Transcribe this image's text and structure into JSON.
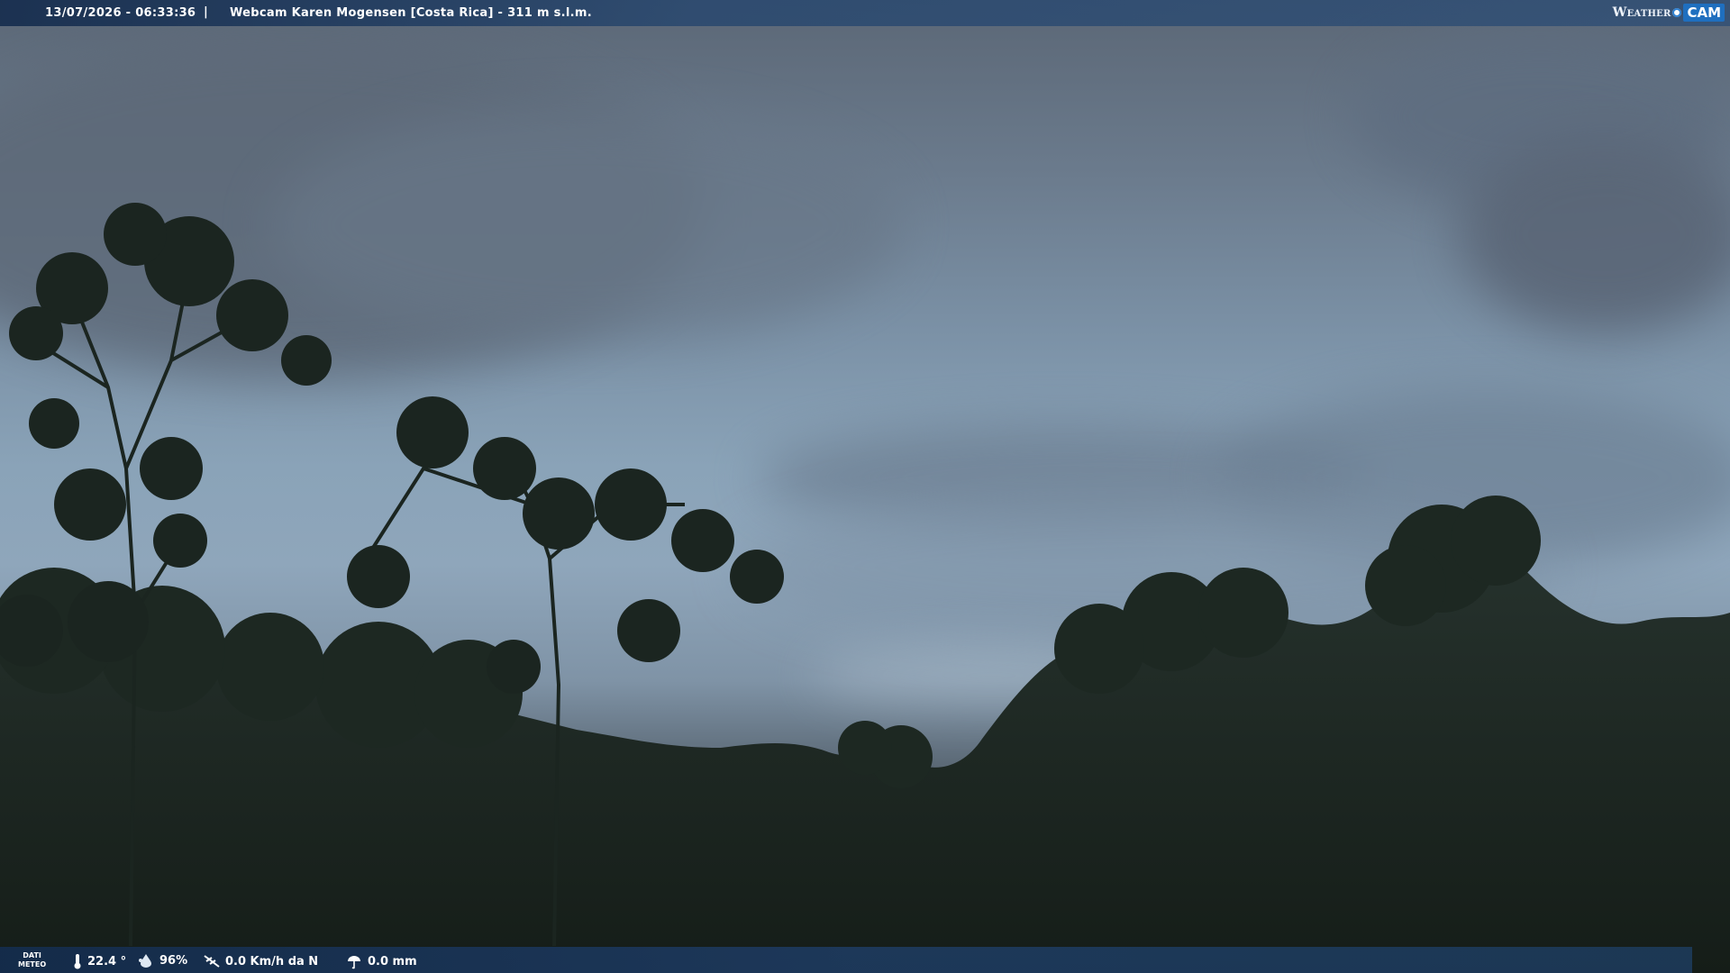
{
  "header": {
    "timestamp": "13/07/2026 - 06:33:36",
    "separator": "|",
    "title": "Webcam Karen Mogensen [Costa Rica]  - 311 m s.l.m."
  },
  "logo": {
    "text_left": "Weather",
    "text_right": "CAM"
  },
  "footer": {
    "dati_line1": "DATI",
    "dati_line2": "METEO",
    "temperature": "22.4 °",
    "humidity": "96%",
    "wind": "0.0 Km/h da N",
    "rain": "0.0 mm",
    "icons": [
      "thermometer-icon",
      "humidity-icon",
      "wind-icon",
      "rain-icon"
    ]
  },
  "colors": {
    "bar": "#1c3a63",
    "sky": "#8aa3b8",
    "foliage": "#1a241e",
    "logo_accent": "#1f6fbf"
  }
}
